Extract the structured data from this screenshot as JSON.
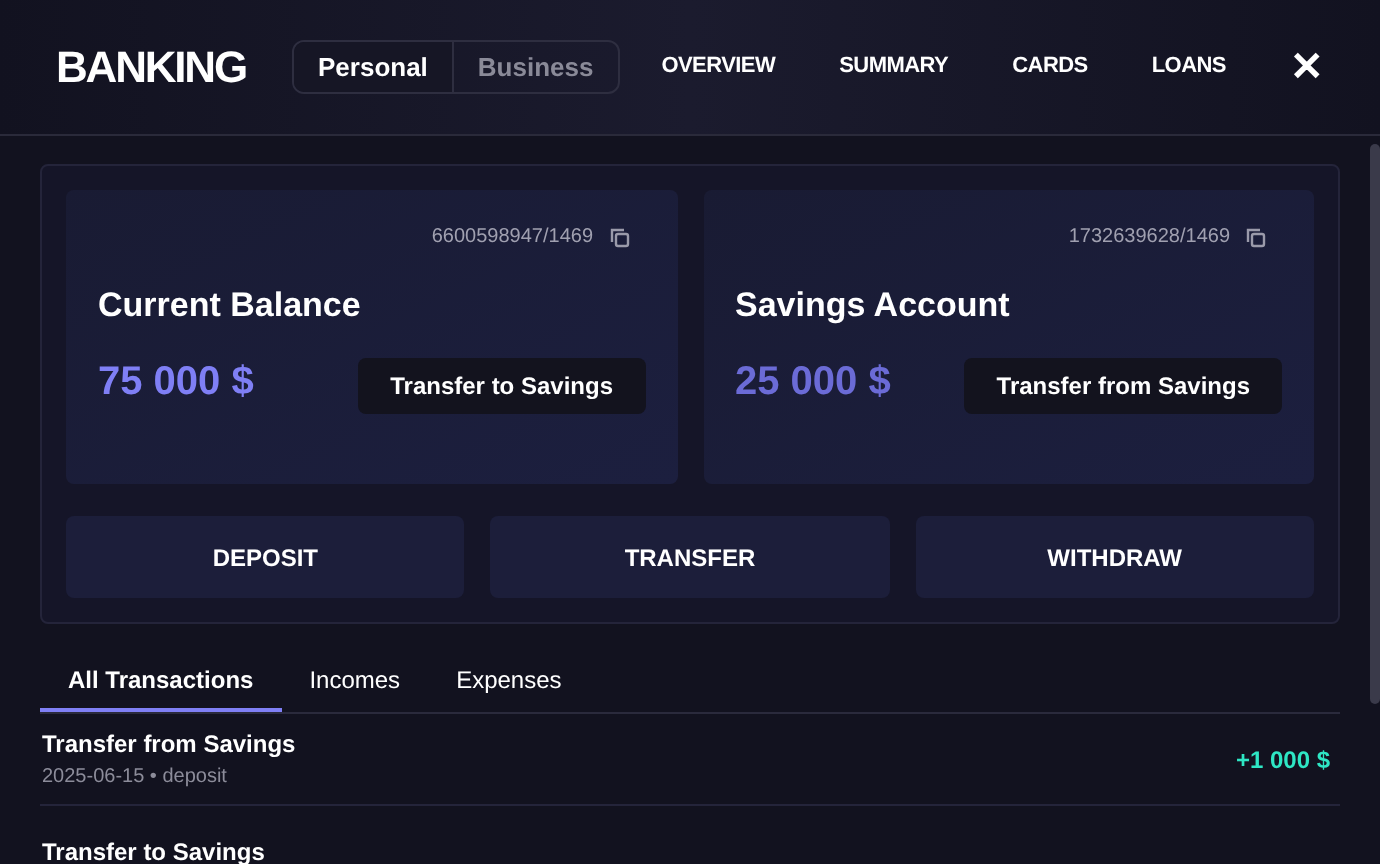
{
  "header": {
    "logo": "BANKING",
    "modes": [
      {
        "label": "Personal",
        "selected": true
      },
      {
        "label": "Business",
        "selected": false
      }
    ],
    "nav": [
      "OVERVIEW",
      "SUMMARY",
      "CARDS",
      "LOANS"
    ],
    "close": "✕"
  },
  "accounts": [
    {
      "number": "6600598947/1469",
      "title": "Current Balance",
      "amount": "75 000 $",
      "color": "#7f7ff5",
      "action": "Transfer to Savings"
    },
    {
      "number": "1732639628/1469",
      "title": "Savings Account",
      "amount": "25 000 $",
      "color": "#6b6bd6",
      "action": "Transfer from Savings"
    }
  ],
  "actions": [
    "DEPOSIT",
    "TRANSFER",
    "WITHDRAW"
  ],
  "tabs": [
    {
      "label": "All Transactions",
      "selected": true
    },
    {
      "label": "Incomes",
      "selected": false
    },
    {
      "label": "Expenses",
      "selected": false
    }
  ],
  "transactions": [
    {
      "title": "Transfer from Savings",
      "meta": "2025-06-15 • deposit",
      "amount": "+1 000 $",
      "kind": "income"
    },
    {
      "title": "Transfer to Savings"
    }
  ]
}
